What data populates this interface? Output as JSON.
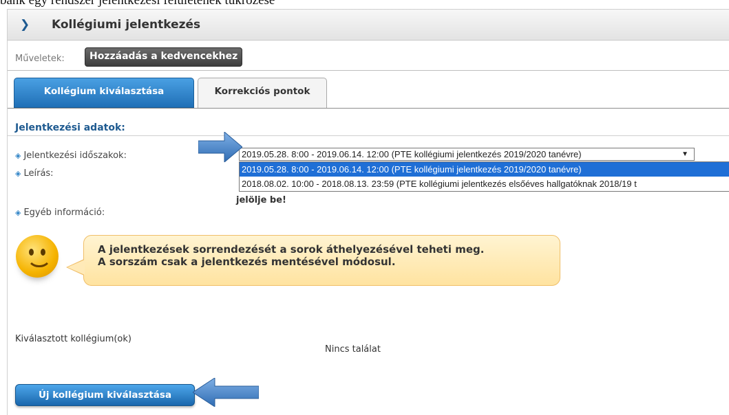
{
  "intro_text": "bank egy rendszer jelentkezési felületének tükrözése",
  "panel": {
    "title": "Kollégiumi jelentkezés"
  },
  "actions": {
    "label": "Műveletek:",
    "add_favorite_label": "Hozzáadás a kedvencekhez"
  },
  "tabs": [
    {
      "label": "Kollégium kiválasztása",
      "active": true
    },
    {
      "label": "Korrekciós pontok",
      "active": false
    }
  ],
  "section_title": "Jelentkezési adatok:",
  "fields": {
    "periods_label": "Jelentkezési időszakok:",
    "description_label": "Leírás:",
    "other_info_label": "Egyéb információ:"
  },
  "periods_select": {
    "value": "2019.05.28. 8:00 - 2019.06.14. 12:00 (PTE kollégiumi jelentkezés 2019/2020 tanévre)",
    "options": [
      "2019.05.28. 8:00 - 2019.06.14. 12:00 (PTE kollégiumi jelentkezés 2019/2020 tanévre)",
      "2018.08.02. 10:00 - 2018.08.13. 23:59 (PTE kollégiumi jelentkezés elsőéves hallgatóknak 2018/19 t"
    ]
  },
  "description_tail": "jelölje be!",
  "info_bubble": {
    "line1": "A jelentkezések sorrendezését a sorok áthelyezésével teheti meg.",
    "line2": "A sorszám csak a jelentkezés mentésével módosul."
  },
  "selected_label": "Kiválasztott kollégium(ok)",
  "no_result": "Nincs találat",
  "new_button_label": "Új kollégium kiválasztása",
  "colors": {
    "accent_blue": "#1f6fb6",
    "arrow_blue": "#4a86c8",
    "bubble_border": "#f0be68",
    "bubble_fill": "#ffe9b4"
  },
  "icons": {
    "title": "chevron-right-icon",
    "field_bullet": "diamond-bullet-icon",
    "pointer": "arrow-icon",
    "mascot": "smiley-icon"
  }
}
